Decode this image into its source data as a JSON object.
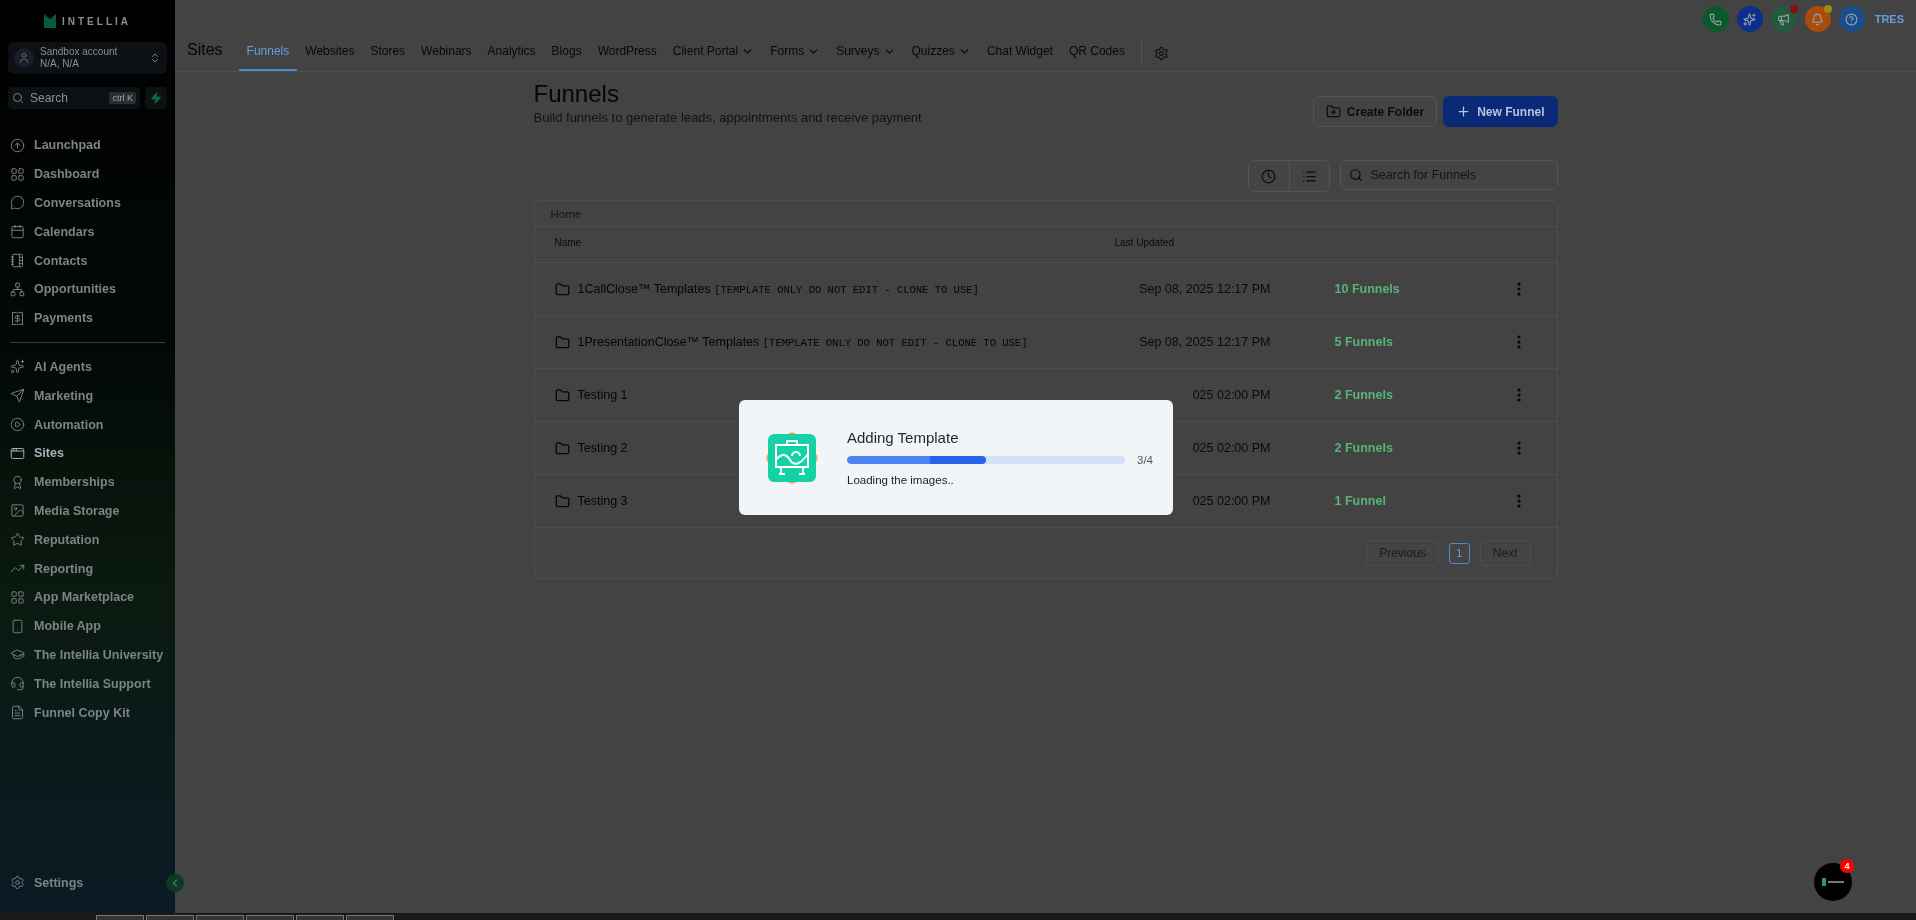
{
  "sidebar": {
    "brand": "INTELLIA",
    "account": {
      "name": "Sandbox account",
      "location": "N/A, N/A"
    },
    "search": {
      "placeholder": "Search",
      "shortcut": "ctrl K"
    },
    "items": [
      {
        "label": "Launchpad",
        "selected": false
      },
      {
        "label": "Dashboard",
        "selected": false
      },
      {
        "label": "Conversations",
        "selected": false
      },
      {
        "label": "Calendars",
        "selected": false
      },
      {
        "label": "Contacts",
        "selected": false
      },
      {
        "label": "Opportunities",
        "selected": false
      },
      {
        "label": "Payments",
        "selected": false
      }
    ],
    "items_2": [
      {
        "label": "AI Agents",
        "selected": false
      },
      {
        "label": "Marketing",
        "selected": false
      },
      {
        "label": "Automation",
        "selected": false
      },
      {
        "label": "Sites",
        "selected": true
      },
      {
        "label": "Memberships",
        "selected": false
      },
      {
        "label": "Media Storage",
        "selected": false
      },
      {
        "label": "Reputation",
        "selected": false
      },
      {
        "label": "Reporting",
        "selected": false
      },
      {
        "label": "App Marketplace",
        "selected": false
      },
      {
        "label": "Mobile App",
        "selected": false
      },
      {
        "label": "The Intellia University",
        "selected": false
      },
      {
        "label": "The Intellia Support",
        "selected": false
      },
      {
        "label": "Funnel Copy Kit",
        "selected": false
      }
    ],
    "settings": "Settings"
  },
  "header": {
    "section": "Sites",
    "tabs": [
      {
        "label": "Funnels",
        "selected": true,
        "dropdown": false
      },
      {
        "label": "Websites",
        "selected": false,
        "dropdown": false
      },
      {
        "label": "Stores",
        "selected": false,
        "dropdown": false
      },
      {
        "label": "Webinars",
        "selected": false,
        "dropdown": false
      },
      {
        "label": "Analytics",
        "selected": false,
        "dropdown": false
      },
      {
        "label": "Blogs",
        "selected": false,
        "dropdown": false
      },
      {
        "label": "WordPress",
        "selected": false,
        "dropdown": false
      },
      {
        "label": "Client Portal",
        "selected": false,
        "dropdown": true
      },
      {
        "label": "Forms",
        "selected": false,
        "dropdown": true
      },
      {
        "label": "Surveys",
        "selected": false,
        "dropdown": true
      },
      {
        "label": "Quizzes",
        "selected": false,
        "dropdown": true
      },
      {
        "label": "Chat Widget",
        "selected": false,
        "dropdown": false
      },
      {
        "label": "QR Codes",
        "selected": false,
        "dropdown": false
      }
    ],
    "actions": [
      {
        "kind": "phone",
        "color": "#0b5a2c",
        "dot": false
      },
      {
        "kind": "sparkle",
        "color": "#0b2f8a",
        "dot": false
      },
      {
        "kind": "megaphone",
        "color": "#245a3c",
        "dot": true
      },
      {
        "kind": "bell",
        "color": "#a84c0c",
        "dot": true
      },
      {
        "kind": "help",
        "color": "#1a4d8c",
        "dot": false
      }
    ],
    "user": "TRES"
  },
  "page": {
    "title": "Funnels",
    "subtitle": "Build funnels to generate leads, appointments and receive payment",
    "buttons": [
      {
        "label": "Create Folder",
        "kind": "secondary"
      },
      {
        "label": "New Funnel",
        "kind": "primary"
      }
    ],
    "search": {
      "placeholder": "Search for Funnels"
    },
    "breadcrumb": "Home",
    "table": {
      "columns": [
        "Name",
        "Last Updated"
      ],
      "rows": [
        {
          "name": "1CallClose™ Templates",
          "note": "[TEMPLATE ONLY DO NOT EDIT - CLONE TO USE]",
          "updated": "Sep 08, 2025 12:17 PM",
          "count": "10 Funnels"
        },
        {
          "name": "1PresentationClose™ Templates",
          "note": "[TEMPLATE ONLY DO NOT EDIT - CLONE TO USE]",
          "updated": "Sep 08, 2025 12:17 PM",
          "count": "5 Funnels"
        },
        {
          "name": "Testing 1",
          "updated": "025 02:00 PM",
          "count": "2 Funnels"
        },
        {
          "name": "Testing 2",
          "updated": "025 02:00 PM",
          "count": "2 Funnels"
        },
        {
          "name": "Testing 3",
          "updated": "025 02:00 PM",
          "count": "1 Funnel"
        }
      ]
    },
    "pagination": {
      "previous": {
        "label": "Previous",
        "disabled": true
      },
      "pages": [
        {
          "label": "1",
          "selected": true
        }
      ],
      "next": {
        "label": "Next",
        "disabled": true
      }
    }
  },
  "modal": {
    "title": "Adding Template",
    "level": 0.5,
    "step": "3/4",
    "message": "Loading the images.."
  },
  "chat": {
    "badge": "4"
  }
}
